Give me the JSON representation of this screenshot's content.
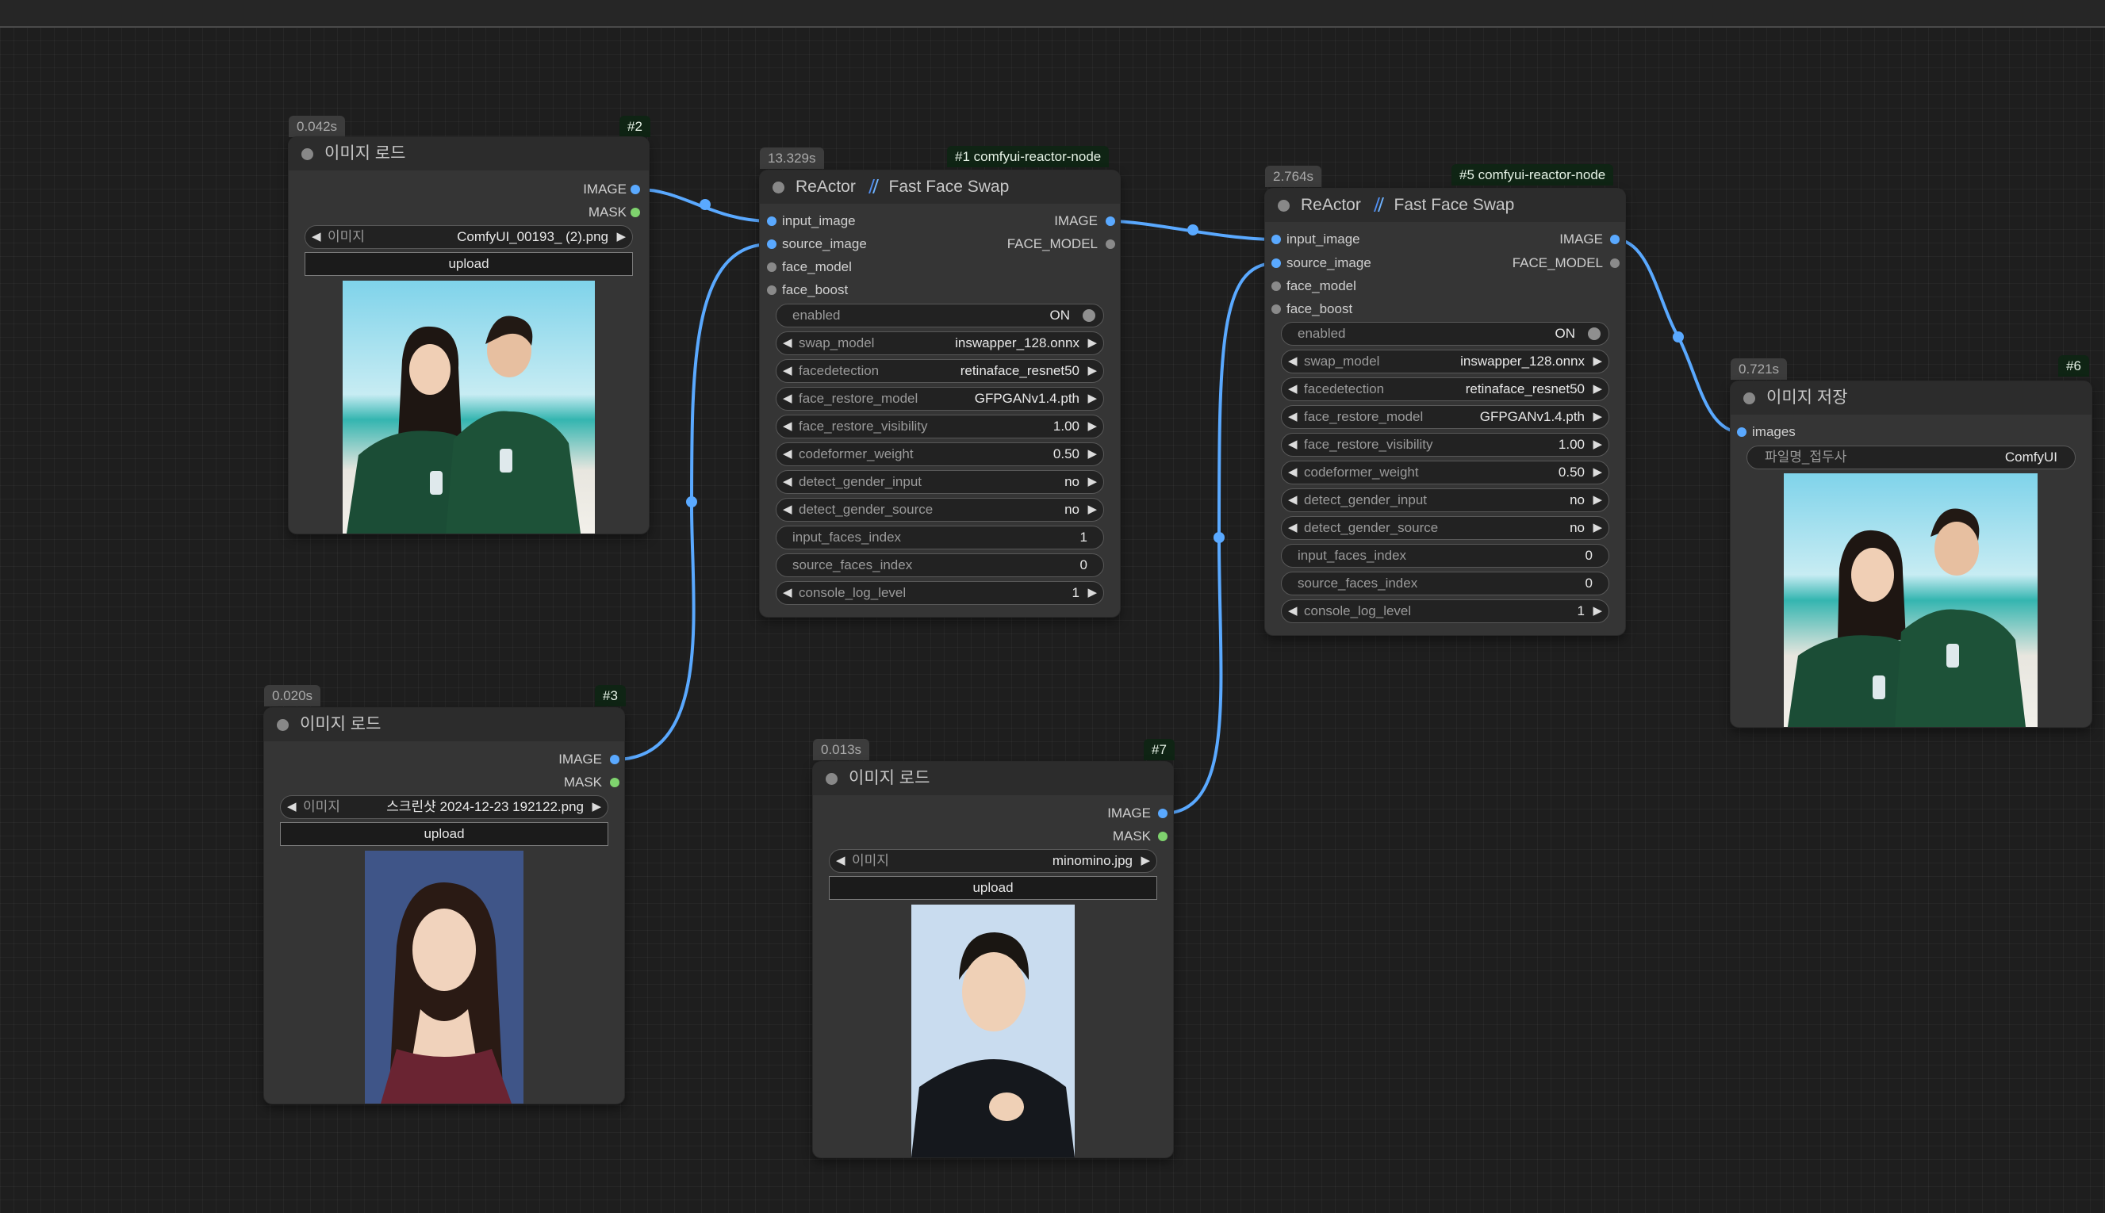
{
  "nodes": {
    "load2": {
      "time": "0.042s",
      "id": "#2",
      "title": "이미지 로드",
      "out_image": "IMAGE",
      "out_mask": "MASK",
      "image_label": "이미지",
      "image_value": "ComfyUI_00193_ (2).png",
      "upload": "upload"
    },
    "load3": {
      "time": "0.020s",
      "id": "#3",
      "title": "이미지 로드",
      "out_image": "IMAGE",
      "out_mask": "MASK",
      "image_label": "이미지",
      "image_value": "스크린샷 2024-12-23 192122.png",
      "upload": "upload"
    },
    "load7": {
      "time": "0.013s",
      "id": "#7",
      "title": "이미지 로드",
      "out_image": "IMAGE",
      "out_mask": "MASK",
      "image_label": "이미지",
      "image_value": "minomino.jpg",
      "upload": "upload"
    },
    "reactor1": {
      "time": "13.329s",
      "id": "#1 comfyui-reactor-node",
      "title_a": "ReActor",
      "title_b": "Fast Face Swap",
      "inputs": [
        "input_image",
        "source_image",
        "face_model",
        "face_boost"
      ],
      "outputs": [
        "IMAGE",
        "FACE_MODEL"
      ],
      "enabled": {
        "label": "enabled",
        "value": "ON"
      },
      "combos": [
        {
          "label": "swap_model",
          "value": "inswapper_128.onnx"
        },
        {
          "label": "facedetection",
          "value": "retinaface_resnet50"
        },
        {
          "label": "face_restore_model",
          "value": "GFPGANv1.4.pth"
        },
        {
          "label": "face_restore_visibility",
          "value": "1.00"
        },
        {
          "label": "codeformer_weight",
          "value": "0.50"
        },
        {
          "label": "detect_gender_input",
          "value": "no"
        },
        {
          "label": "detect_gender_source",
          "value": "no"
        }
      ],
      "input_faces_index": {
        "label": "input_faces_index",
        "value": "1"
      },
      "source_faces_index": {
        "label": "source_faces_index",
        "value": "0"
      },
      "console_log_level": {
        "label": "console_log_level",
        "value": "1"
      }
    },
    "reactor5": {
      "time": "2.764s",
      "id": "#5 comfyui-reactor-node",
      "title_a": "ReActor",
      "title_b": "Fast Face Swap",
      "inputs": [
        "input_image",
        "source_image",
        "face_model",
        "face_boost"
      ],
      "outputs": [
        "IMAGE",
        "FACE_MODEL"
      ],
      "enabled": {
        "label": "enabled",
        "value": "ON"
      },
      "combos": [
        {
          "label": "swap_model",
          "value": "inswapper_128.onnx"
        },
        {
          "label": "facedetection",
          "value": "retinaface_resnet50"
        },
        {
          "label": "face_restore_model",
          "value": "GFPGANv1.4.pth"
        },
        {
          "label": "face_restore_visibility",
          "value": "1.00"
        },
        {
          "label": "codeformer_weight",
          "value": "0.50"
        },
        {
          "label": "detect_gender_input",
          "value": "no"
        },
        {
          "label": "detect_gender_source",
          "value": "no"
        }
      ],
      "input_faces_index": {
        "label": "input_faces_index",
        "value": "0"
      },
      "source_faces_index": {
        "label": "source_faces_index",
        "value": "0"
      },
      "console_log_level": {
        "label": "console_log_level",
        "value": "1"
      }
    },
    "save6": {
      "time": "0.721s",
      "id": "#6",
      "title": "이미지 저장",
      "in_images": "images",
      "prefix_label": "파일명_접두사",
      "prefix_value": "ComfyUI"
    }
  },
  "colors": {
    "link": "#5aa9ff",
    "image_pin": "#5aa9ff",
    "mask_pin": "#7fd36e",
    "id_badge_bg": "#0f2414",
    "node_bg": "#353535",
    "canvas_bg": "#1e1e1e"
  },
  "icons": {
    "reactor_icon": "lightning-slash-icon",
    "arrow_left": "triangle-left-icon",
    "arrow_right": "triangle-right-icon",
    "status_dot": "circle-dot-icon"
  }
}
